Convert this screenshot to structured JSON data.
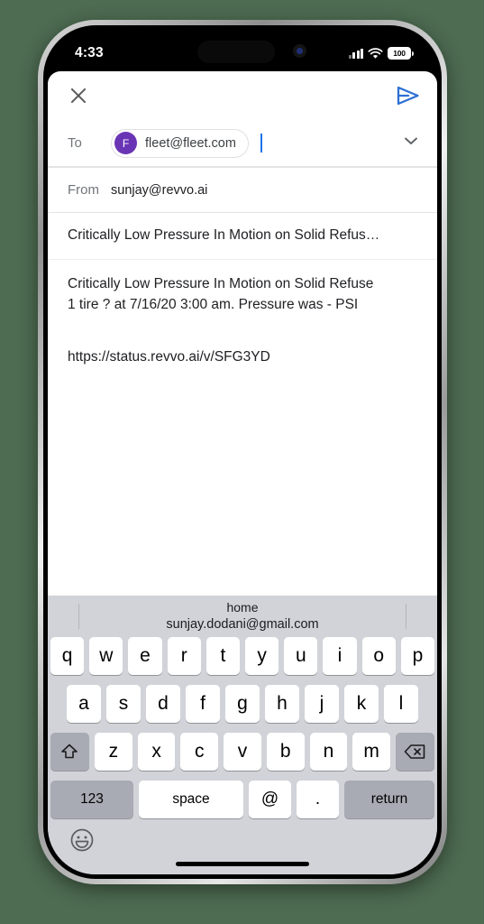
{
  "status_bar": {
    "time": "4:33",
    "battery_level": "100",
    "signal_icon": "cellular-bars-icon",
    "wifi_icon": "wifi-icon",
    "battery_icon": "battery-icon"
  },
  "compose": {
    "close_icon": "close-x-icon",
    "send_icon": "send-paper-plane-icon",
    "to_label": "To",
    "recipient_initial": "F",
    "recipient_email": "fleet@fleet.com",
    "expand_icon": "chevron-down-icon",
    "from_label": "From",
    "from_value": "sunjay@revvo.ai",
    "subject": "Critically Low Pressure In Motion on Solid Refus…",
    "body_line_1": "Critically Low Pressure In Motion on Solid Refuse",
    "body_line_2": "1 tire ? at 7/16/20 3:00 am. Pressure was - PSI",
    "body_url": "https://status.revvo.ai/v/SFG3YD",
    "accent_color": "#1a73e8",
    "avatar_color": "#6a35b5"
  },
  "keyboard": {
    "suggestion_top": "home",
    "suggestion_bottom": "sunjay.dodani@gmail.com",
    "row1": [
      "q",
      "w",
      "e",
      "r",
      "t",
      "y",
      "u",
      "i",
      "o",
      "p"
    ],
    "row2": [
      "a",
      "s",
      "d",
      "f",
      "g",
      "h",
      "j",
      "k",
      "l"
    ],
    "row3": [
      "z",
      "x",
      "c",
      "v",
      "b",
      "n",
      "m"
    ],
    "shift_icon": "shift-arrow-icon",
    "delete_icon": "backspace-delete-icon",
    "numbers_key": "123",
    "space_key": "space",
    "at_key": "@",
    "dot_key": ".",
    "return_key": "return",
    "emoji_icon": "emoji-smiley-icon"
  }
}
